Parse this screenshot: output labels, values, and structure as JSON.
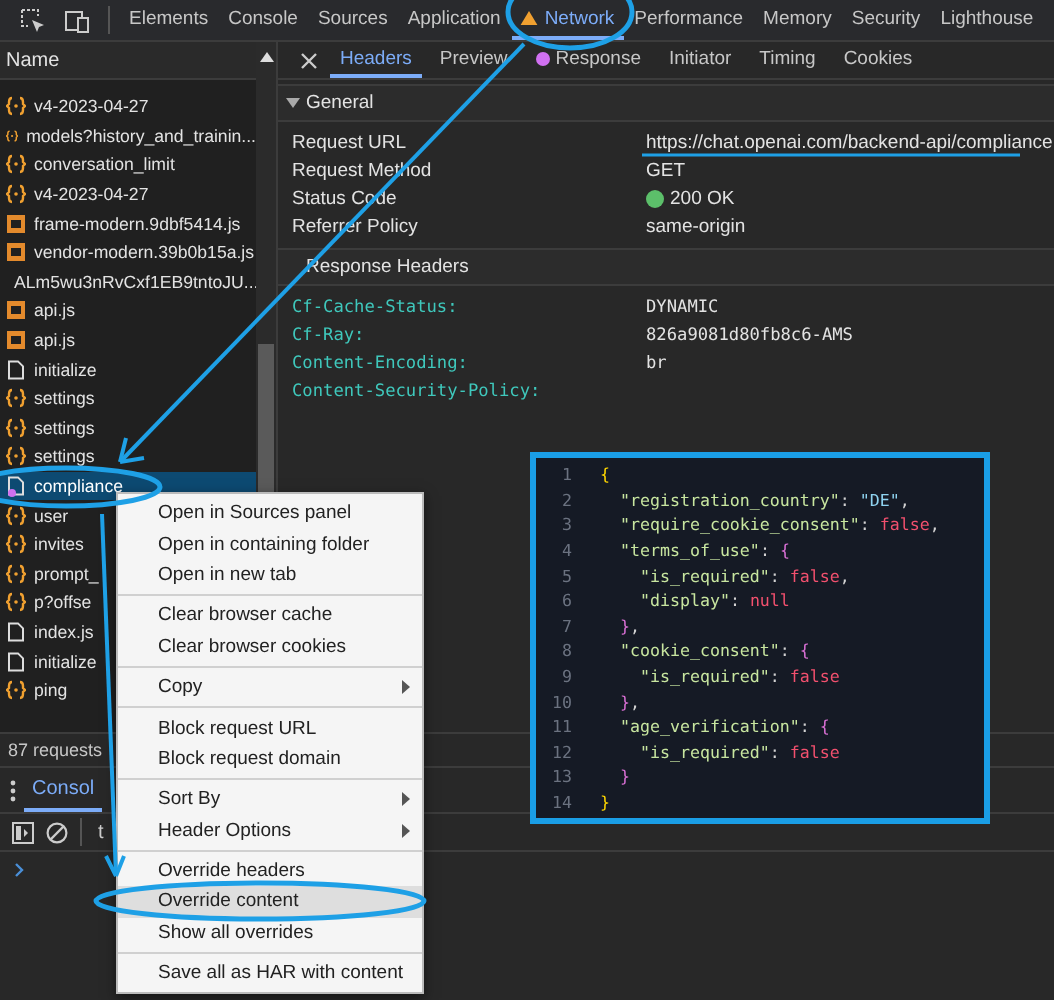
{
  "top_tabs": [
    {
      "label": "Elements",
      "selected": false,
      "warning": false
    },
    {
      "label": "Console",
      "selected": false,
      "warning": false
    },
    {
      "label": "Sources",
      "selected": false,
      "warning": false
    },
    {
      "label": "Application",
      "selected": false,
      "warning": false
    },
    {
      "label": "Network",
      "selected": true,
      "warning": true
    },
    {
      "label": "Performance",
      "selected": false,
      "warning": false
    },
    {
      "label": "Memory",
      "selected": false,
      "warning": false
    },
    {
      "label": "Security",
      "selected": false,
      "warning": false
    },
    {
      "label": "Lighthouse",
      "selected": false,
      "warning": false
    }
  ],
  "requests": {
    "header": "Name",
    "items": [
      {
        "name": "v4-2023-04-27",
        "kind": "fetch",
        "selected": false
      },
      {
        "name": "models?history_and_trainin...",
        "kind": "fetch",
        "selected": false
      },
      {
        "name": "conversation_limit",
        "kind": "fetch",
        "selected": false
      },
      {
        "name": "v4-2023-04-27",
        "kind": "fetch",
        "selected": false
      },
      {
        "name": "frame-modern.9dbf5414.js",
        "kind": "script",
        "selected": false
      },
      {
        "name": "vendor-modern.39b0b15a.js",
        "kind": "script",
        "selected": false
      },
      {
        "name": "ALm5wu3nRvCxf1EB9tntoJU...",
        "kind": "image",
        "selected": false
      },
      {
        "name": "api.js",
        "kind": "script",
        "selected": false
      },
      {
        "name": "api.js",
        "kind": "script",
        "selected": false
      },
      {
        "name": "initialize",
        "kind": "doc",
        "selected": false
      },
      {
        "name": "settings",
        "kind": "fetch",
        "selected": false
      },
      {
        "name": "settings",
        "kind": "fetch",
        "selected": false
      },
      {
        "name": "settings",
        "kind": "fetch",
        "selected": false
      },
      {
        "name": "compliance",
        "kind": "override",
        "selected": true
      },
      {
        "name": "user",
        "kind": "fetch",
        "selected": false
      },
      {
        "name": "invites",
        "kind": "fetch",
        "selected": false
      },
      {
        "name": "prompt_",
        "kind": "fetch",
        "selected": false
      },
      {
        "name": "p?offse",
        "kind": "fetch",
        "selected": false
      },
      {
        "name": "index.js",
        "kind": "doc",
        "selected": false
      },
      {
        "name": "initialize",
        "kind": "doc",
        "selected": false
      },
      {
        "name": "ping",
        "kind": "fetch",
        "selected": false
      }
    ],
    "status": "87 requests"
  },
  "detail_tabs": [
    {
      "label": "Headers",
      "selected": true,
      "dot": false
    },
    {
      "label": "Preview",
      "selected": false,
      "dot": false
    },
    {
      "label": "Response",
      "selected": false,
      "dot": true
    },
    {
      "label": "Initiator",
      "selected": false,
      "dot": false
    },
    {
      "label": "Timing",
      "selected": false,
      "dot": false
    },
    {
      "label": "Cookies",
      "selected": false,
      "dot": false
    }
  ],
  "general": {
    "title": "General",
    "rows": [
      {
        "key": "Request URL",
        "value": "https://chat.openai.com/backend-api/compliance"
      },
      {
        "key": "Request Method",
        "value": "GET"
      },
      {
        "key": "Status Code",
        "value": "200 OK",
        "color": "#5cbf6a"
      },
      {
        "key": "Referrer Policy",
        "value": "same-origin"
      }
    ]
  },
  "response_headers": {
    "title": "Response Headers",
    "rows": [
      {
        "key": "Cf-Cache-Status:",
        "value": "DYNAMIC"
      },
      {
        "key": "Cf-Ray:",
        "value": "826a9081d80fb8c6-AMS"
      },
      {
        "key": "Content-Encoding:",
        "value": "br"
      },
      {
        "key": "Content-Security-Policy:"
      }
    ]
  },
  "drawer": {
    "tab": "Consol",
    "filter": "t"
  },
  "context_menu": {
    "groups": [
      [
        {
          "label": "Open in Sources panel",
          "submenu": false,
          "highlighted": false
        },
        {
          "label": "Open in containing folder",
          "submenu": false,
          "highlighted": false
        },
        {
          "label": "Open in new tab",
          "submenu": false,
          "highlighted": false
        }
      ],
      [
        {
          "label": "Clear browser cache",
          "submenu": false,
          "highlighted": false
        },
        {
          "label": "Clear browser cookies",
          "submenu": false,
          "highlighted": false
        }
      ],
      [
        {
          "label": "Copy",
          "submenu": true,
          "highlighted": false
        }
      ],
      [
        {
          "label": "Block request URL",
          "submenu": false,
          "highlighted": false
        },
        {
          "label": "Block request domain",
          "submenu": false,
          "highlighted": false
        }
      ],
      [
        {
          "label": "Sort By",
          "submenu": true,
          "highlighted": false
        },
        {
          "label": "Header Options",
          "submenu": true,
          "highlighted": false
        }
      ],
      [
        {
          "label": "Override headers",
          "submenu": false,
          "highlighted": false
        },
        {
          "label": "Override content",
          "submenu": false,
          "highlighted": true
        },
        {
          "label": "Show all overrides",
          "submenu": false,
          "highlighted": false
        }
      ],
      [
        {
          "label": "Save all as HAR with content",
          "submenu": false,
          "highlighted": false
        }
      ]
    ]
  },
  "code": [
    {
      "number": "1",
      "tokens": [
        {
          "kind": "brace",
          "text": "{"
        }
      ]
    },
    {
      "number": "2",
      "tokens": [
        {
          "kind": "key",
          "text": "  \"registration_country\""
        },
        {
          "kind": "punct",
          "text": ": "
        },
        {
          "kind": "string",
          "text": "\"DE\""
        },
        {
          "kind": "punct",
          "text": ","
        }
      ]
    },
    {
      "number": "3",
      "tokens": [
        {
          "kind": "key",
          "text": "  \"require_cookie_consent\""
        },
        {
          "kind": "punct",
          "text": ": "
        },
        {
          "kind": "literal",
          "text": "false"
        },
        {
          "kind": "punct",
          "text": ","
        }
      ]
    },
    {
      "number": "4",
      "tokens": [
        {
          "kind": "key",
          "text": "  \"terms_of_use\""
        },
        {
          "kind": "punct",
          "text": ": "
        },
        {
          "kind": "brace2",
          "text": "{"
        }
      ]
    },
    {
      "number": "5",
      "tokens": [
        {
          "kind": "key",
          "text": "    \"is_required\""
        },
        {
          "kind": "punct",
          "text": ": "
        },
        {
          "kind": "literal",
          "text": "false"
        },
        {
          "kind": "punct",
          "text": ","
        }
      ]
    },
    {
      "number": "6",
      "tokens": [
        {
          "kind": "key",
          "text": "    \"display\""
        },
        {
          "kind": "punct",
          "text": ": "
        },
        {
          "kind": "literal",
          "text": "null"
        }
      ]
    },
    {
      "number": "7",
      "tokens": [
        {
          "kind": "brace2",
          "text": "  }"
        },
        {
          "kind": "punct",
          "text": ","
        }
      ]
    },
    {
      "number": "8",
      "tokens": [
        {
          "kind": "key",
          "text": "  \"cookie_consent\""
        },
        {
          "kind": "punct",
          "text": ": "
        },
        {
          "kind": "brace2",
          "text": "{"
        }
      ]
    },
    {
      "number": "9",
      "tokens": [
        {
          "kind": "key",
          "text": "    \"is_required\""
        },
        {
          "kind": "punct",
          "text": ": "
        },
        {
          "kind": "literal",
          "text": "false"
        }
      ]
    },
    {
      "number": "10",
      "tokens": [
        {
          "kind": "brace2",
          "text": "  }"
        },
        {
          "kind": "punct",
          "text": ","
        }
      ]
    },
    {
      "number": "11",
      "tokens": [
        {
          "kind": "key",
          "text": "  \"age_verification\""
        },
        {
          "kind": "punct",
          "text": ": "
        },
        {
          "kind": "brace2",
          "text": "{"
        }
      ]
    },
    {
      "number": "12",
      "tokens": [
        {
          "kind": "key",
          "text": "    \"is_required\""
        },
        {
          "kind": "punct",
          "text": ": "
        },
        {
          "kind": "literal",
          "text": "false"
        }
      ]
    },
    {
      "number": "13",
      "tokens": [
        {
          "kind": "brace2",
          "text": "  }"
        }
      ]
    },
    {
      "number": "14",
      "tokens": [
        {
          "kind": "brace",
          "text": "}"
        }
      ]
    }
  ]
}
